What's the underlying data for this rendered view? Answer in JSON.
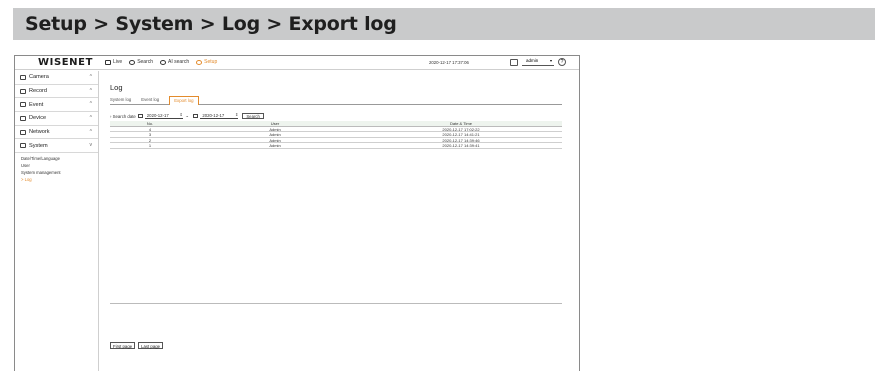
{
  "banner": {
    "title": "Setup > System > Log > Export log"
  },
  "topbar": {
    "logo": "WISENET",
    "nav": [
      {
        "label": "Live",
        "icon": "monitor-icon",
        "active": false
      },
      {
        "label": "Search",
        "icon": "search-icon",
        "active": false
      },
      {
        "label": "AI search",
        "icon": "ai-search-icon",
        "active": false
      },
      {
        "label": "Setup",
        "icon": "gear-icon",
        "active": true
      }
    ],
    "datetime": "2020-12-17 17:37:06",
    "user": "admin",
    "help": "?"
  },
  "sidebar": {
    "items": [
      {
        "label": "Camera",
        "icon": "camera-icon",
        "chevron": "^"
      },
      {
        "label": "Record",
        "icon": "record-icon",
        "chevron": "^"
      },
      {
        "label": "Event",
        "icon": "event-icon",
        "chevron": "^"
      },
      {
        "label": "Device",
        "icon": "device-icon",
        "chevron": "^"
      },
      {
        "label": "Network",
        "icon": "network-icon",
        "chevron": "^"
      },
      {
        "label": "System",
        "icon": "system-icon",
        "chevron": "v"
      }
    ],
    "submenu": [
      {
        "label": "Date/Time/Language",
        "active": false
      },
      {
        "label": "User",
        "active": false
      },
      {
        "label": "System management",
        "active": false
      },
      {
        "label": "> Log",
        "active": true
      }
    ]
  },
  "main": {
    "title": "Log",
    "tabs": [
      {
        "label": "System log",
        "active": false
      },
      {
        "label": "Event log",
        "active": false
      },
      {
        "label": "Export log",
        "active": true
      }
    ],
    "search": {
      "label": "› Search date",
      "from": "2020-12-17",
      "to": "2020-12-17",
      "button": "Search"
    },
    "table": {
      "headers": [
        "No.",
        "User",
        "Date & Time"
      ],
      "rows": [
        [
          "4",
          "Admin",
          "2020-12-17 17:02:22"
        ],
        [
          "3",
          "Admin",
          "2020-12-17 14:41:21"
        ],
        [
          "2",
          "Admin",
          "2020-12-17 14:39:46"
        ],
        [
          "1",
          "Admin",
          "2020-12-17 14:39:41"
        ]
      ]
    },
    "pager": {
      "first": "First page",
      "last": "Last page"
    }
  },
  "colors": {
    "accent": "#e38b2c",
    "banner": "#c9cacb",
    "header_row": "#eef4ee"
  }
}
